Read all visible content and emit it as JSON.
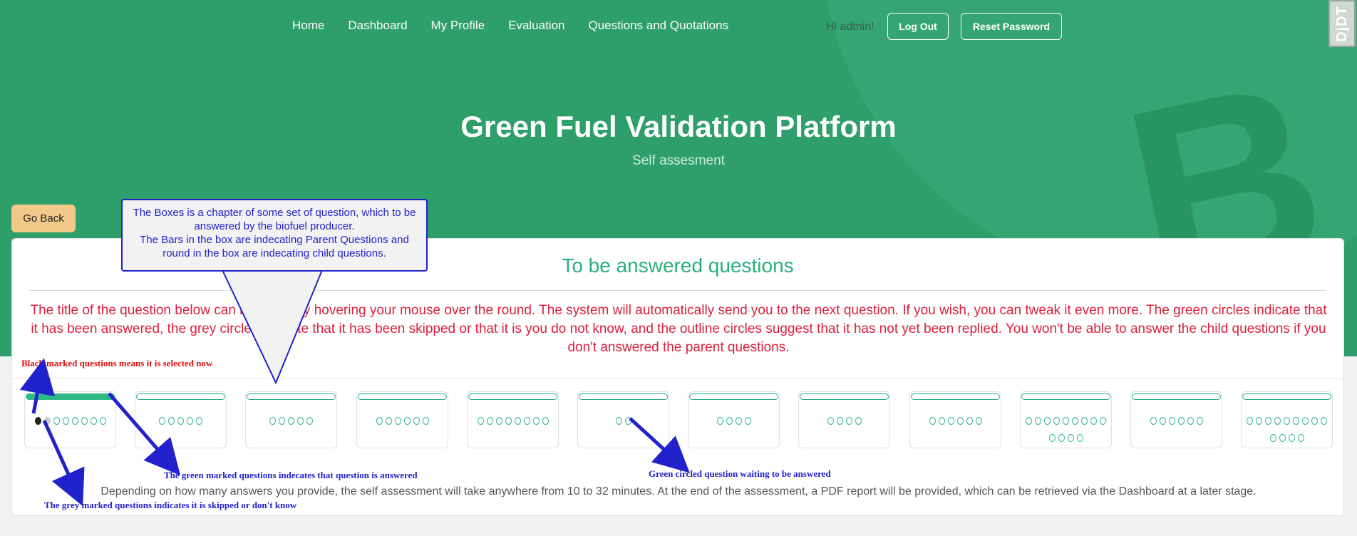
{
  "nav": {
    "items": [
      "Home",
      "Dashboard",
      "My Profile",
      "Evaluation",
      "Questions and Quotations"
    ],
    "greeting": "Hi admin!",
    "logout_label": "Log Out",
    "reset_label": "Reset Password"
  },
  "corner_badge": "DjDT",
  "hero": {
    "title": "Green Fuel Validation Platform",
    "subtitle": "Self assesment"
  },
  "go_back_label": "Go Back",
  "card": {
    "title": "To be answered questions",
    "instructions": "The title of the question below can be found by hovering your mouse over the round. The system will automatically send you to the next question. If you wish, you can tweak it even more. The green circles indicate that it has been answered, the grey circles indicate that it has been skipped or that it is you do not know, and the outline circles suggest that it has not yet been replied. You won't be able to answer the child questions if you don't answered the parent questions.",
    "footer": "Depending on how many answers you provide, the self assessment will take anywhere from 10 to 32 minutes. At the end of the assessment, a PDF report will be provided, which can be retrieved via the Dashboard at a later stage."
  },
  "chapters": [
    {
      "parent": "answered",
      "children": [
        "current",
        "skipped",
        "open",
        "open",
        "open",
        "open",
        "open",
        "open"
      ]
    },
    {
      "parent": "open",
      "children": [
        "open",
        "open",
        "open",
        "open",
        "open"
      ]
    },
    {
      "parent": "open",
      "children": [
        "open",
        "open",
        "open",
        "open",
        "open"
      ]
    },
    {
      "parent": "open",
      "children": [
        "open",
        "open",
        "open",
        "open",
        "open",
        "open"
      ]
    },
    {
      "parent": "open",
      "children": [
        "open",
        "open",
        "open",
        "open",
        "open",
        "open",
        "open",
        "open"
      ]
    },
    {
      "parent": "open",
      "children": [
        "open",
        "open"
      ]
    },
    {
      "parent": "open",
      "children": [
        "open",
        "open",
        "open",
        "open"
      ]
    },
    {
      "parent": "open",
      "children": [
        "open",
        "open",
        "open",
        "open"
      ]
    },
    {
      "parent": "open",
      "children": [
        "open",
        "open",
        "open",
        "open",
        "open",
        "open"
      ]
    },
    {
      "parent": "open",
      "children": [
        "open",
        "open",
        "open",
        "open",
        "open",
        "open",
        "open",
        "open",
        "open",
        "open",
        "open",
        "open",
        "open"
      ]
    },
    {
      "parent": "open",
      "children": [
        "open",
        "open",
        "open",
        "open",
        "open",
        "open"
      ]
    },
    {
      "parent": "open",
      "children": [
        "open",
        "open",
        "open",
        "open",
        "open",
        "open",
        "open",
        "open",
        "open",
        "open",
        "open",
        "open",
        "open"
      ]
    }
  ],
  "annotations": {
    "callout": "The Boxes is a chapter of some set of question, which to be answered by the biofuel producer.\nThe Bars in the box are indecating Parent Questions and round in the box are indecating child questions.",
    "black_marked": "Black marked questions means it is selected now",
    "green_marked": "The green marked questions indecates that question is answered",
    "green_circled": "Green circled question waiting to be answered",
    "grey_marked": "The grey marked questions indicates it is skipped or don't know"
  },
  "colors": {
    "brand_green": "#2e9e6b",
    "answered": "#2fb986",
    "skipped": "#c9ccca",
    "selected": "#222222",
    "instruction_red": "#dc1e3c",
    "annotation_blue": "#2222cc",
    "go_back": "#f3c98a"
  }
}
